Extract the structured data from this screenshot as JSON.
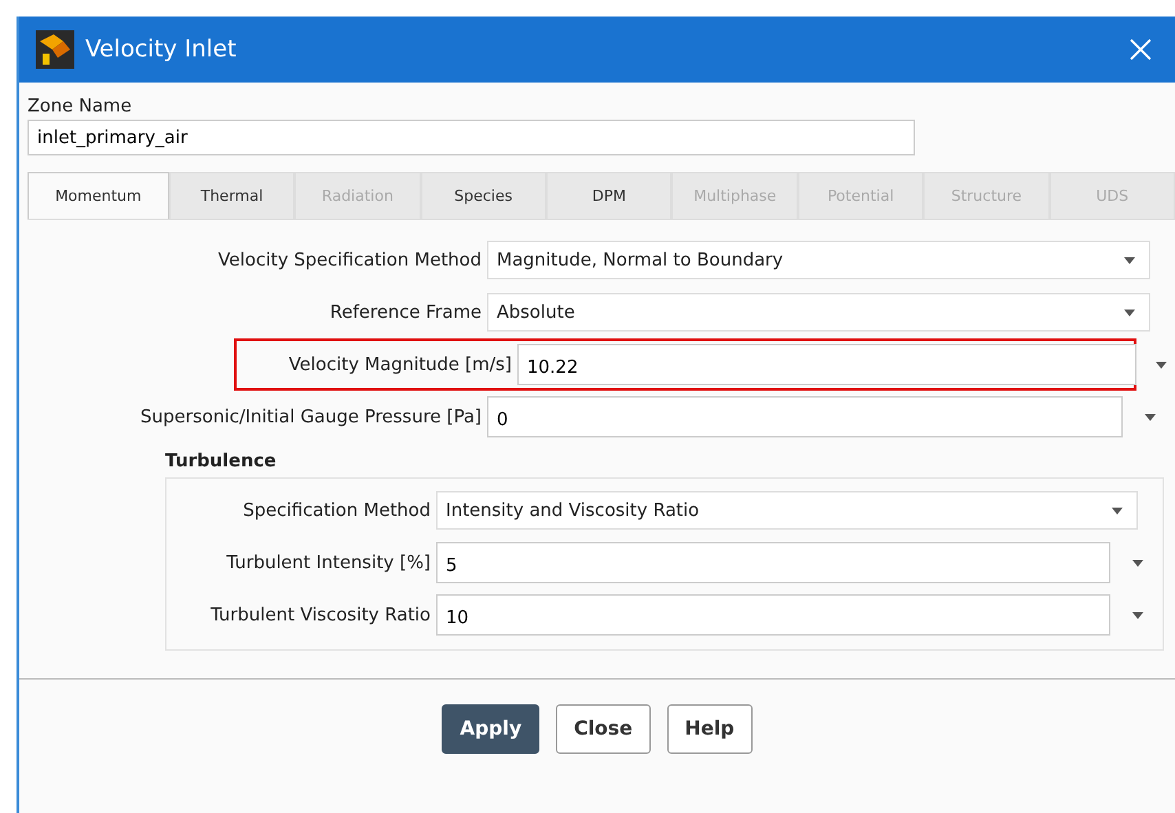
{
  "window": {
    "title": "Velocity Inlet"
  },
  "zone_name": {
    "label": "Zone Name",
    "value": "inlet_primary_air"
  },
  "tabs": [
    {
      "label": "Momentum",
      "selected": true,
      "disabled": false
    },
    {
      "label": "Thermal",
      "selected": false,
      "disabled": false
    },
    {
      "label": "Radiation",
      "selected": false,
      "disabled": true
    },
    {
      "label": "Species",
      "selected": false,
      "disabled": false
    },
    {
      "label": "DPM",
      "selected": false,
      "disabled": false
    },
    {
      "label": "Multiphase",
      "selected": false,
      "disabled": true
    },
    {
      "label": "Potential",
      "selected": false,
      "disabled": true
    },
    {
      "label": "Structure",
      "selected": false,
      "disabled": true
    },
    {
      "label": "UDS",
      "selected": false,
      "disabled": true
    }
  ],
  "fields": [
    {
      "kind": "dropdown",
      "label": "Velocity Specification Method",
      "value": "Magnitude, Normal to Boundary",
      "highlighted": false
    },
    {
      "kind": "dropdown",
      "label": "Reference Frame",
      "value": "Absolute",
      "highlighted": false
    },
    {
      "kind": "number",
      "label": "Velocity Magnitude [m/s]",
      "value": "10.22",
      "highlighted": true
    },
    {
      "kind": "number",
      "label": "Supersonic/Initial Gauge Pressure [Pa]",
      "value": "0",
      "highlighted": false
    }
  ],
  "turbulence": {
    "title": "Turbulence",
    "fields": [
      {
        "kind": "dropdown",
        "label": "Specification Method",
        "value": "Intensity and Viscosity Ratio",
        "highlighted": false
      },
      {
        "kind": "number",
        "label": "Turbulent Intensity [%]",
        "value": "5",
        "highlighted": false
      },
      {
        "kind": "number",
        "label": "Turbulent Viscosity Ratio",
        "value": "10",
        "highlighted": false
      }
    ]
  },
  "buttons": [
    {
      "label": "Apply",
      "kind": "primary"
    },
    {
      "label": "Close",
      "kind": "secondary"
    },
    {
      "label": "Help",
      "kind": "secondary"
    }
  ]
}
